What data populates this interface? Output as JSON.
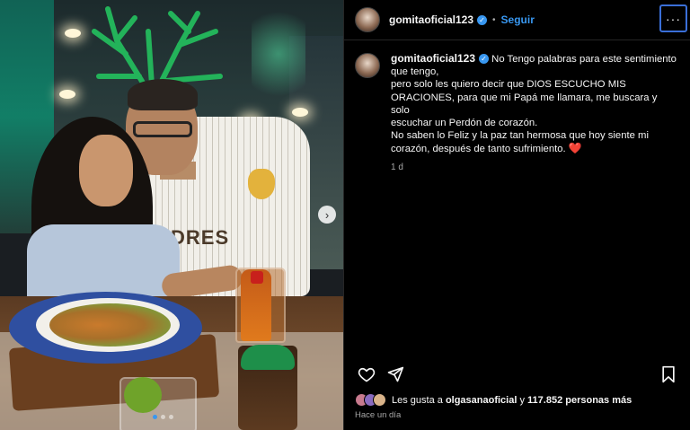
{
  "post": {
    "username": "gomitaoficial123",
    "follow_label": "Seguir",
    "more_label": "···",
    "caption_lines": [
      "No Tengo palabras para este sentimiento",
      "que tengo,",
      "pero solo les quiero decir que DIOS ESCUCHO MIS",
      "ORACIONES, para que mi Papá me llamara, me buscara y solo",
      "escuchar un Perdón de corazón.",
      "No saben lo Feliz y la paz tan hermosa que hoy siente mi",
      "corazón, después de tanto sufrimiento."
    ],
    "caption_emoji": "❤️",
    "time_short": "1 d",
    "likes_prefix": "Les gusta a ",
    "likes_user": "olgasanaoficial",
    "likes_middle": " y ",
    "likes_count": "117.852 personas más",
    "time_long": "Hace un día",
    "jersey_text": "DRES",
    "next_arrow": "›"
  },
  "colors": {
    "accent": "#3897f0",
    "heart": "#e0245e"
  },
  "carousel": {
    "total": 3,
    "active": 1
  },
  "icons": [
    "heart-icon",
    "share-icon",
    "bookmark-icon",
    "verified-icon",
    "more-icon",
    "chevron-right-icon"
  ]
}
